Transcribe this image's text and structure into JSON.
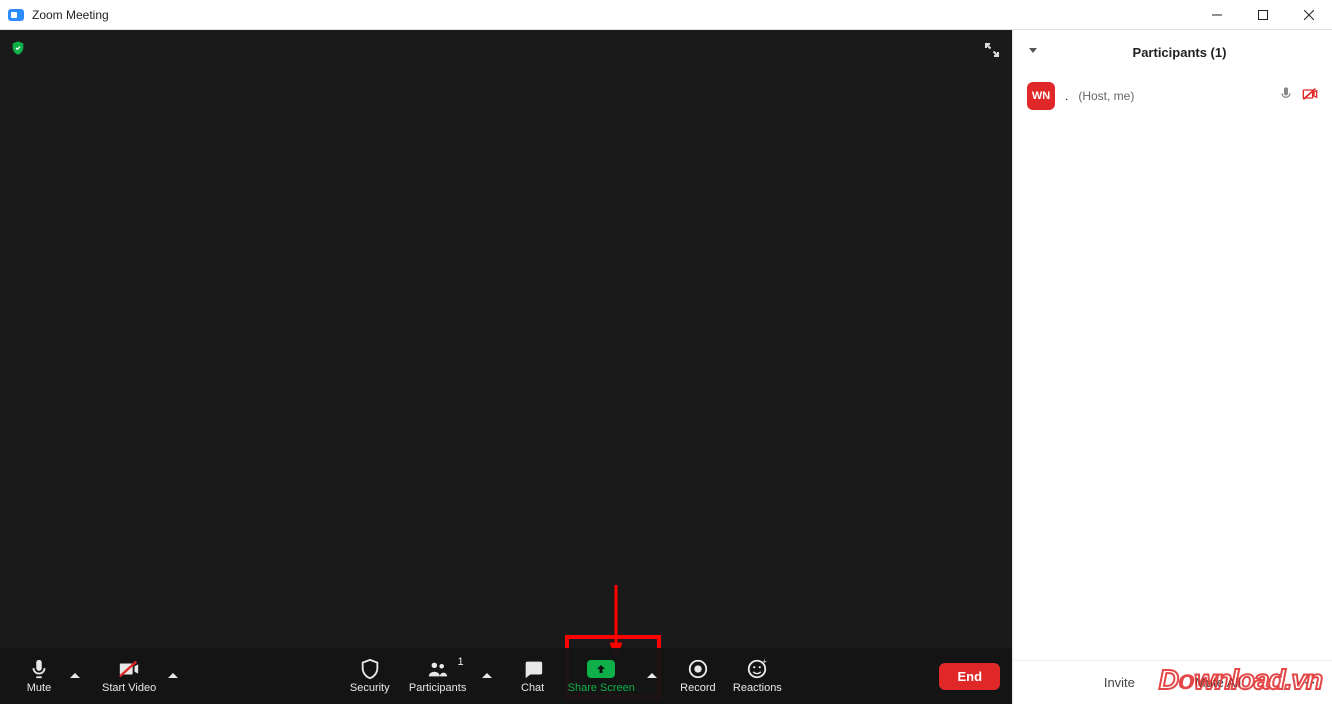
{
  "window": {
    "title": "Zoom Meeting"
  },
  "toolbar": {
    "mute": "Mute",
    "start_video": "Start Video",
    "security": "Security",
    "participants": "Participants",
    "participants_count": "1",
    "chat": "Chat",
    "share_screen": "Share Screen",
    "record": "Record",
    "reactions": "Reactions",
    "end": "End"
  },
  "participants_panel": {
    "title": "Participants (1)",
    "rows": [
      {
        "avatar": "WN",
        "name": ".",
        "role": "(Host, me)"
      }
    ],
    "footer": {
      "invite": "Invite",
      "mute_all": "Mute All"
    }
  },
  "watermark": "Download.vn"
}
